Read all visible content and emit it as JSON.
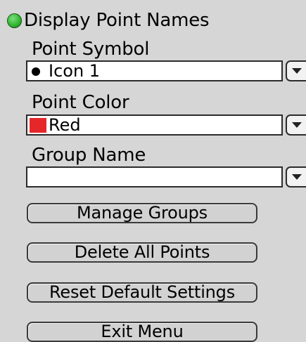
{
  "display_point_names": {
    "label": "Display Point Names",
    "enabled": true,
    "indicator_color": "#2fb52f"
  },
  "point_symbol": {
    "label": "Point Symbol",
    "value": "Icon 1",
    "icon": "filled-circle-icon"
  },
  "point_color": {
    "label": "Point Color",
    "value": "Red",
    "swatch_color": "#e6272a"
  },
  "group_name": {
    "label": "Group Name",
    "value": ""
  },
  "buttons": {
    "manage_groups": "Manage Groups",
    "delete_all_points": "Delete All Points",
    "reset_default_settings": "Reset Default Settings",
    "exit_menu": "Exit Menu"
  },
  "colors": {
    "panel_background": "#d6d6d6",
    "field_background": "#ffffff"
  }
}
